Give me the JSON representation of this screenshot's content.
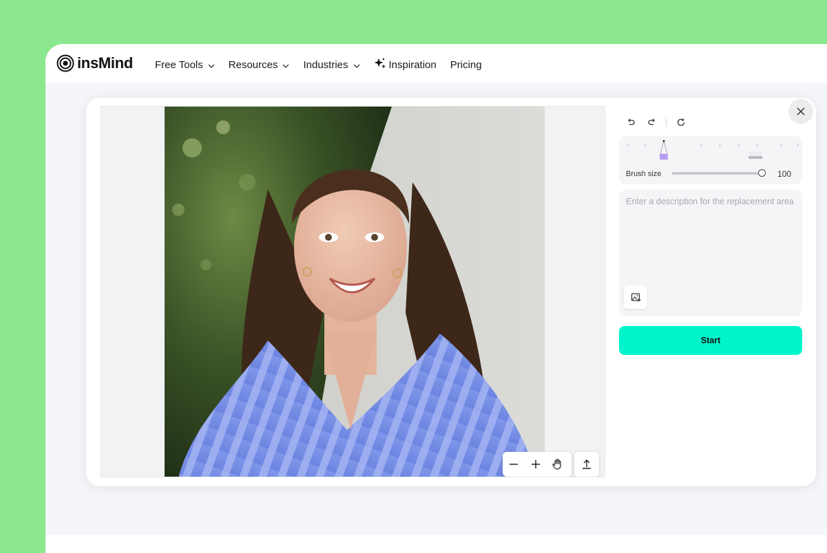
{
  "brand": {
    "name": "insMind"
  },
  "nav": {
    "items": [
      {
        "label": "Free Tools",
        "has_dropdown": true
      },
      {
        "label": "Resources",
        "has_dropdown": true
      },
      {
        "label": "Industries",
        "has_dropdown": true
      },
      {
        "label": "Inspiration",
        "icon": "sparkle-icon"
      },
      {
        "label": "Pricing"
      }
    ]
  },
  "editor": {
    "photo": {
      "description_hidden": ""
    },
    "brush": {
      "label": "Brush size",
      "value": "100",
      "level": 1.0
    },
    "description": {
      "placeholder": "Enter a description for the replacement area",
      "value": ""
    },
    "start_label": "Start"
  },
  "colors": {
    "page_background": "#8be88f",
    "accent": "#00f5cc",
    "brush_marker": "#b79ef0"
  }
}
